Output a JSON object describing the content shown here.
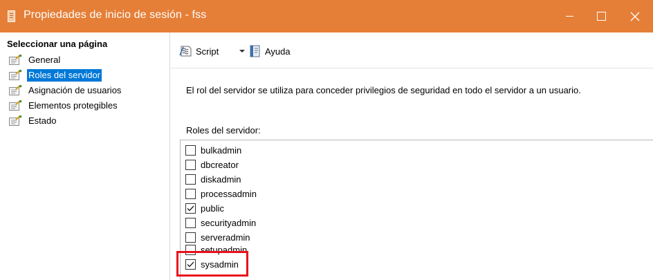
{
  "window": {
    "title": "Propiedades de inicio de sesión - fss",
    "accent_color": "#e57f37"
  },
  "left_pane": {
    "header": "Seleccionar una página",
    "pages": [
      {
        "label": "General",
        "selected": false
      },
      {
        "label": "Roles del servidor",
        "selected": true
      },
      {
        "label": "Asignación de usuarios",
        "selected": false
      },
      {
        "label": "Elementos protegibles",
        "selected": false
      },
      {
        "label": "Estado",
        "selected": false
      }
    ]
  },
  "toolbar": {
    "script_label": "Script",
    "help_label": "Ayuda"
  },
  "main": {
    "description": "El rol del servidor se utiliza para conceder privilegios de seguridad en todo el servidor a un usuario.",
    "roles_heading": "Roles del servidor:",
    "roles": [
      {
        "name": "bulkadmin",
        "checked": false
      },
      {
        "name": "dbcreator",
        "checked": false
      },
      {
        "name": "diskadmin",
        "checked": false
      },
      {
        "name": "processadmin",
        "checked": false
      },
      {
        "name": "public",
        "checked": true
      },
      {
        "name": "securityadmin",
        "checked": false
      },
      {
        "name": "serveradmin",
        "checked": false
      },
      {
        "name": "setupadmin",
        "checked": false
      },
      {
        "name": "sysadmin",
        "checked": true
      }
    ]
  },
  "highlight_color": "#e8111b"
}
